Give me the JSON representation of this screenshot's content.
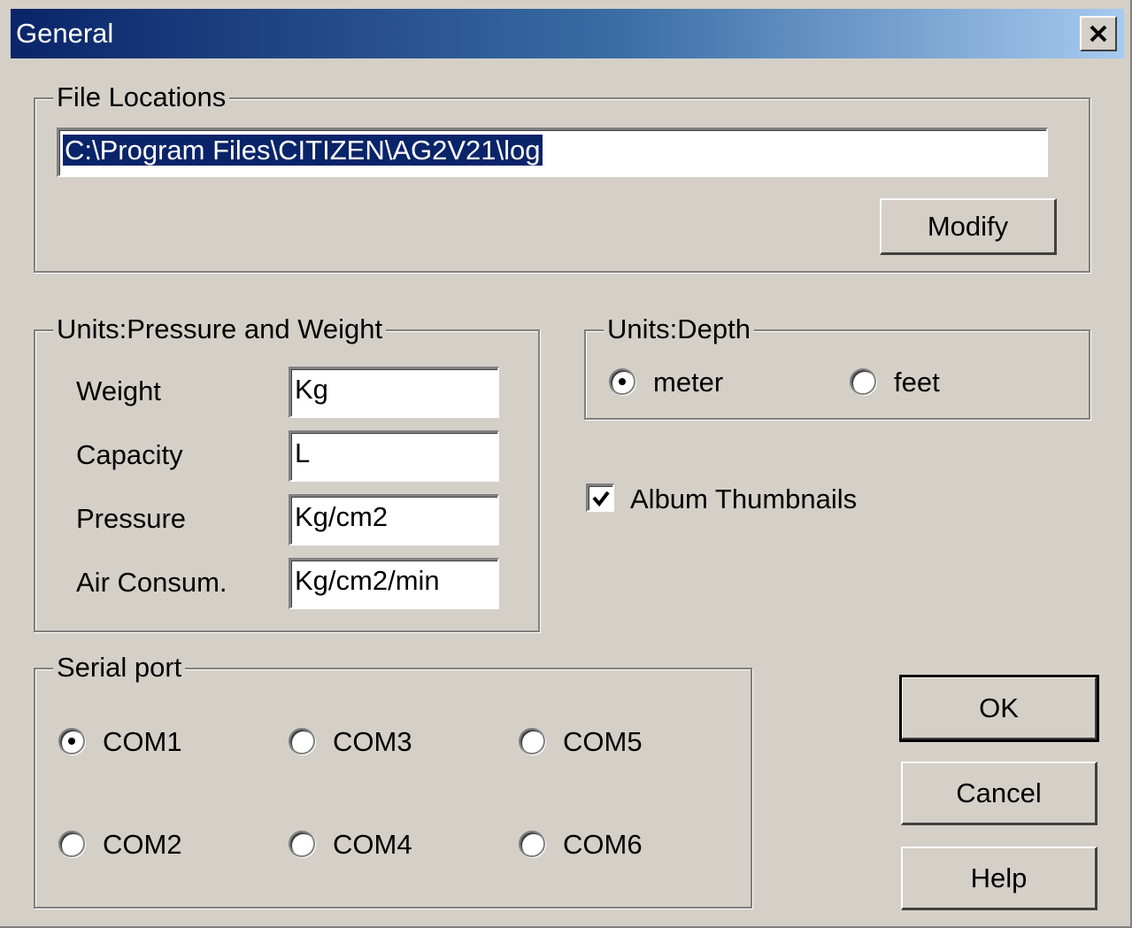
{
  "window": {
    "title": "General",
    "close_glyph": "✕"
  },
  "file_locations": {
    "label": "File Locations",
    "path_value": "C:\\Program Files\\CITIZEN\\AG2V21\\log",
    "modify_label": "Modify"
  },
  "units_pressure_weight": {
    "label": "Units:Pressure and Weight",
    "rows": [
      {
        "label": "Weight",
        "value": "Kg"
      },
      {
        "label": "Capacity",
        "value": "L"
      },
      {
        "label": "Pressure",
        "value": "Kg/cm2"
      },
      {
        "label": "Air Consum.",
        "value": "Kg/cm2/min"
      }
    ]
  },
  "units_depth": {
    "label": "Units:Depth",
    "options": [
      {
        "label": "meter",
        "selected": true
      },
      {
        "label": "feet",
        "selected": false
      }
    ]
  },
  "album_thumbnails": {
    "label": "Album Thumbnails",
    "checked": true
  },
  "serial_port": {
    "label": "Serial port",
    "options": [
      {
        "label": "COM1",
        "selected": true
      },
      {
        "label": "COM2",
        "selected": false
      },
      {
        "label": "COM3",
        "selected": false
      },
      {
        "label": "COM4",
        "selected": false
      },
      {
        "label": "COM5",
        "selected": false
      },
      {
        "label": "COM6",
        "selected": false
      }
    ]
  },
  "buttons": {
    "ok": "OK",
    "cancel": "Cancel",
    "help": "Help"
  },
  "colors": {
    "title_gradient_start": "#0a246a",
    "title_gradient_end": "#a6caf0",
    "dialog_face": "#d4d0c8",
    "selection": "#0a246a"
  }
}
